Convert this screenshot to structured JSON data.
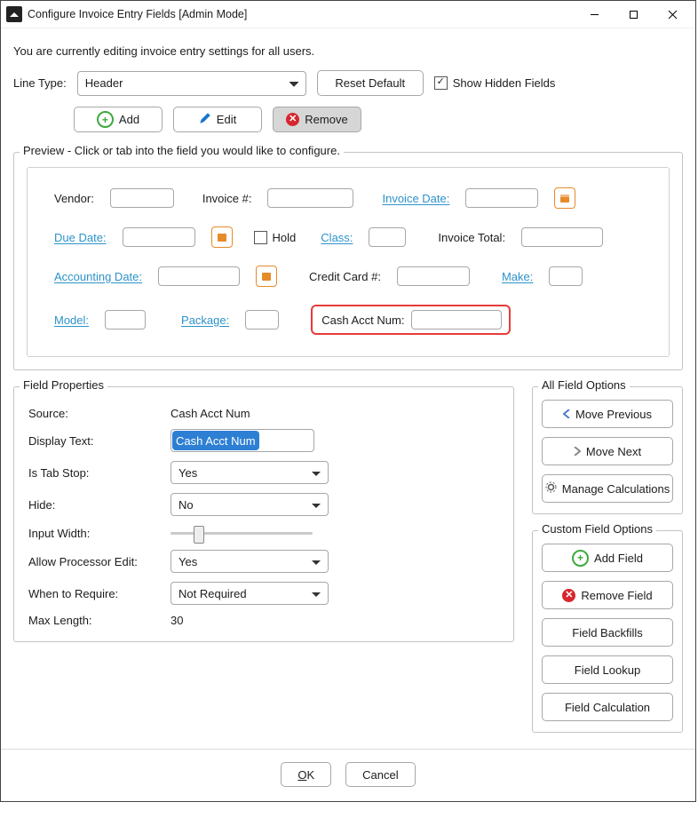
{
  "window": {
    "title": "Configure Invoice Entry Fields [Admin Mode]",
    "notice": "You are currently editing invoice entry settings for all users."
  },
  "line_type": {
    "label": "Line Type:",
    "value": "Header",
    "reset_label": "Reset Default",
    "show_hidden_label": "Show Hidden Fields",
    "show_hidden_checked": true
  },
  "toolbar": {
    "add_label": "Add",
    "edit_label": "Edit",
    "remove_label": "Remove"
  },
  "preview": {
    "legend": "Preview - Click or tab into the field you would like to configure.",
    "labels": {
      "vendor": "Vendor:",
      "invoice_num": "Invoice #:",
      "invoice_date": "Invoice Date:",
      "due_date": "Due Date:",
      "hold": "Hold",
      "class": "Class:",
      "invoice_total": "Invoice Total:",
      "accounting_date": "Accounting Date:",
      "credit_card": "Credit Card #:",
      "make": "Make:",
      "model": "Model:",
      "package": "Package:",
      "cash_acct": "Cash Acct Num:"
    }
  },
  "field_props": {
    "legend": "Field Properties",
    "labels": {
      "source": "Source:",
      "display_text": "Display Text:",
      "is_tab_stop": "Is Tab Stop:",
      "hide": "Hide:",
      "input_width": "Input Width:",
      "allow_processor_edit": "Allow Processor Edit:",
      "when_required": "When to Require:",
      "max_length": "Max Length:"
    },
    "values": {
      "source": "Cash Acct Num",
      "display_text": "Cash Acct Num",
      "is_tab_stop": "Yes",
      "hide": "No",
      "input_width_pct": 17,
      "allow_processor_edit": "Yes",
      "when_required": "Not Required",
      "max_length": "30"
    }
  },
  "all_field_options": {
    "legend": "All Field Options",
    "move_previous": "Move Previous",
    "move_next": "Move Next",
    "manage_calculations": "Manage Calculations"
  },
  "custom_field_options": {
    "legend": "Custom Field Options",
    "add_field": "Add Field",
    "remove_field": "Remove Field",
    "field_backfills": "Field Backfills",
    "field_lookup": "Field Lookup",
    "field_calculation": "Field Calculation"
  },
  "footer": {
    "ok": "OK",
    "cancel": "Cancel"
  }
}
